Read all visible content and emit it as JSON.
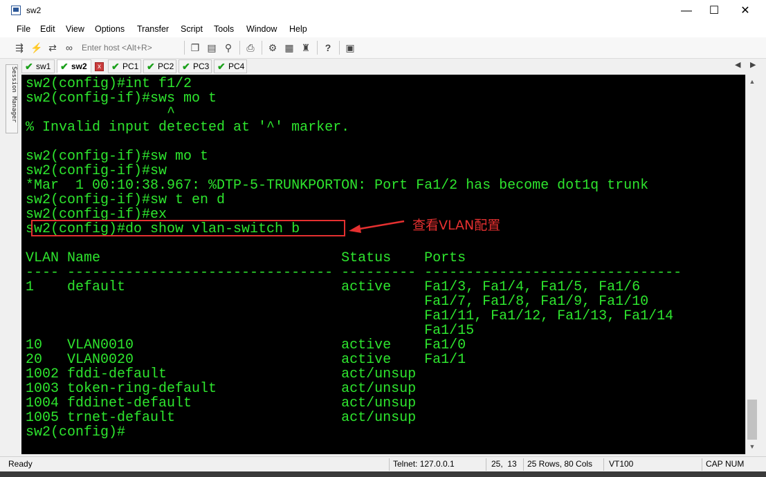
{
  "window": {
    "title": "sw2",
    "minimize": "—",
    "maximize": "☐",
    "close": "✕"
  },
  "menu": [
    "File",
    "Edit",
    "View",
    "Options",
    "Transfer",
    "Script",
    "Tools",
    "Window",
    "Help"
  ],
  "toolbar": {
    "host_placeholder": "Enter host <Alt+R>"
  },
  "tabs": [
    {
      "label": "sw1",
      "active": false
    },
    {
      "label": "sw2",
      "active": true
    },
    {
      "label": "PC1",
      "active": false
    },
    {
      "label": "PC2",
      "active": false
    },
    {
      "label": "PC3",
      "active": false
    },
    {
      "label": "PC4",
      "active": false
    }
  ],
  "tab_close": "x",
  "session_manager": "Session Manager",
  "terminal": {
    "lines": [
      "sw2(config)#int f1/2",
      "sw2(config-if)#sws mo t",
      "                 ^",
      "% Invalid input detected at '^' marker.",
      "",
      "sw2(config-if)#sw mo t",
      "sw2(config-if)#sw",
      "*Mar  1 00:10:38.967: %DTP-5-TRUNKPORTON: Port Fa1/2 has become dot1q trunk",
      "sw2(config-if)#sw t en d",
      "sw2(config-if)#ex",
      "sw2(config)#do show vlan-switch b",
      "",
      "VLAN Name                             Status    Ports",
      "---- -------------------------------- --------- -------------------------------",
      "1    default                          active    Fa1/3, Fa1/4, Fa1/5, Fa1/6",
      "                                                Fa1/7, Fa1/8, Fa1/9, Fa1/10",
      "                                                Fa1/11, Fa1/12, Fa1/13, Fa1/14",
      "                                                Fa1/15",
      "10   VLAN0010                         active    Fa1/0",
      "20   VLAN0020                         active    Fa1/1",
      "1002 fddi-default                     act/unsup",
      "1003 token-ring-default               act/unsup",
      "1004 fddinet-default                  act/unsup",
      "1005 trnet-default                    act/unsup",
      "sw2(config)#"
    ]
  },
  "annotation": "查看VLAN配置",
  "status": {
    "ready": "Ready",
    "telnet": "Telnet: 127.0.0.1",
    "cursor": "25,  13",
    "size": "25 Rows, 80 Cols",
    "term": "VT100",
    "cap": "CAP",
    "num": "NUM"
  },
  "colors": {
    "terminal_fg": "#2ee52e",
    "terminal_bg": "#000000",
    "annotation": "#e53030"
  }
}
